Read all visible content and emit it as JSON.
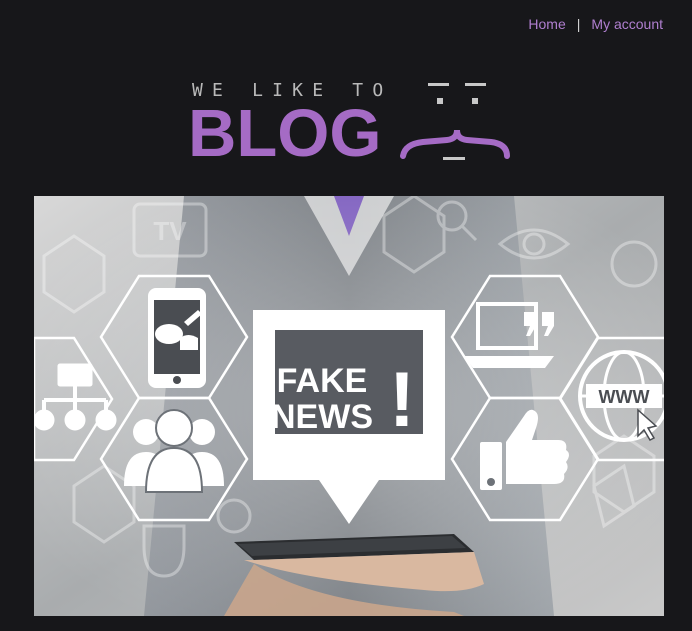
{
  "nav": {
    "home_label": "Home",
    "separator": "|",
    "account_label": "My account"
  },
  "logo": {
    "tagline": "WE LIKE TO",
    "word": "BLOG"
  },
  "hero": {
    "sign_line1": "FAKE",
    "sign_line2": "NEWS",
    "sign_mark": "!",
    "hex_icons": [
      "tv-icon",
      "search-icon",
      "eye-icon",
      "gear-icon",
      "smartphone-chat-icon",
      "network-tree-icon",
      "group-users-icon",
      "laptop-quote-icon",
      "www-globe-icon",
      "thumbs-up-icon",
      "tablet-icon"
    ],
    "www_label": "WWW",
    "tv_label": "TV"
  },
  "colors": {
    "background": "#17171a",
    "accent": "#a56bc5",
    "link": "#b07fd0"
  }
}
